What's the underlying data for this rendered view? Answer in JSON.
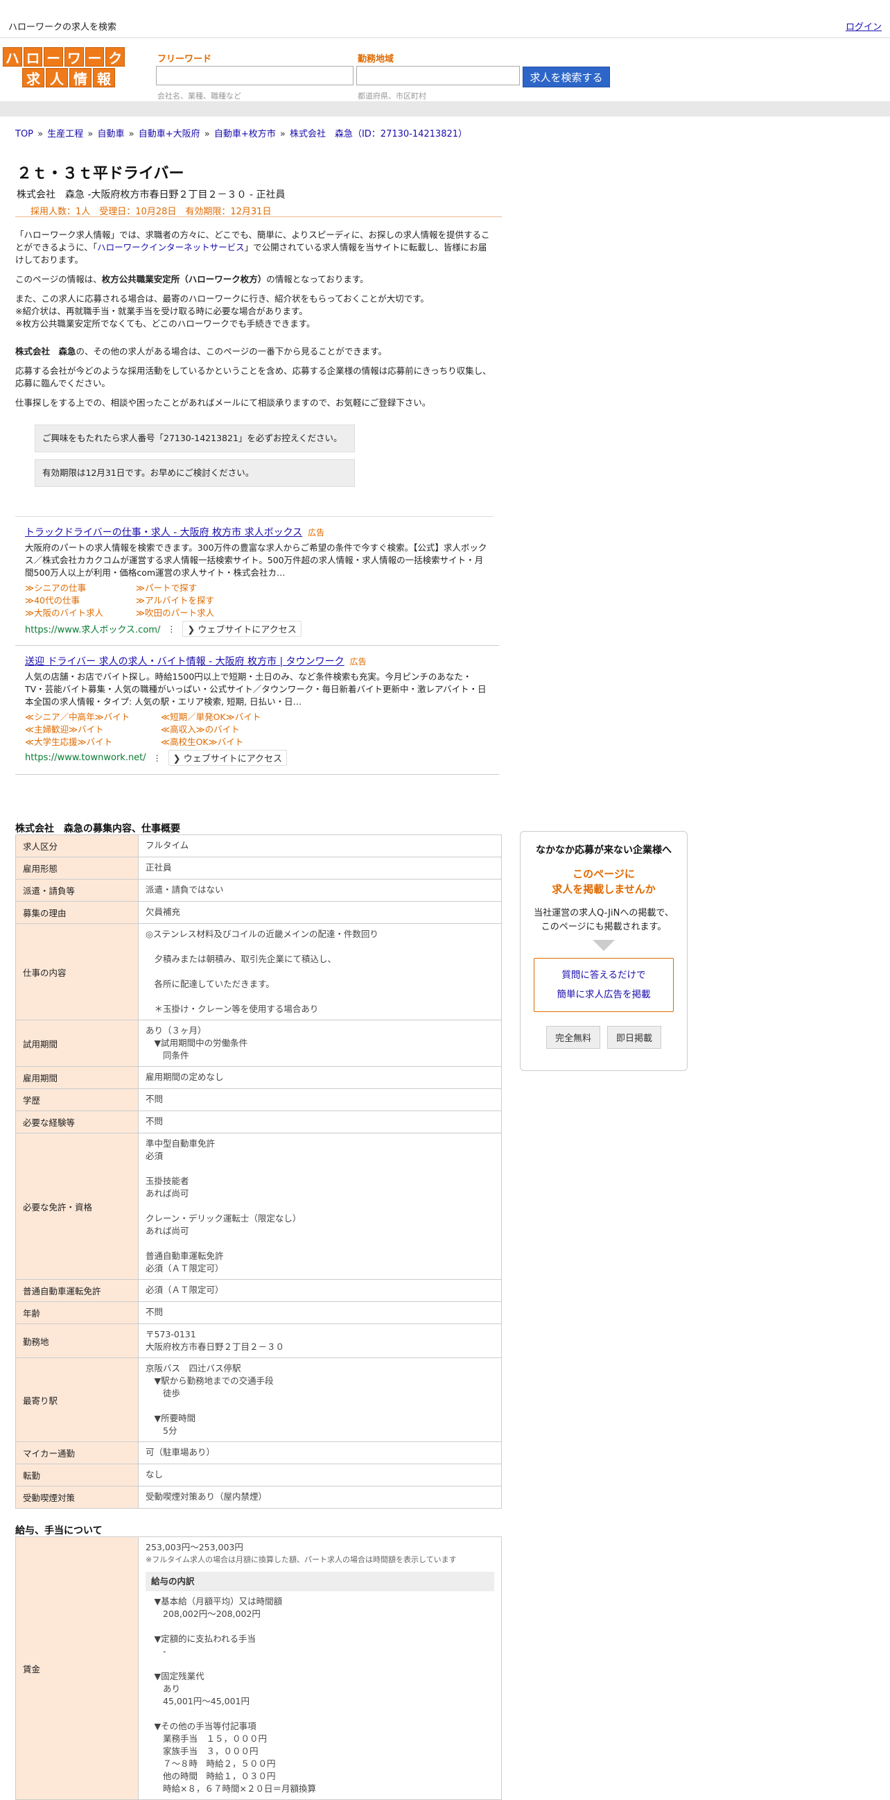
{
  "header": {
    "site_title": "ハローワークの求人を検索",
    "login_label": "ログイン",
    "logo": {
      "row1": [
        "ハ",
        "ロ",
        "ー",
        "ワ",
        "ー",
        "ク"
      ],
      "row2": [
        "求",
        "人",
        "情",
        "報"
      ]
    },
    "keyword_label": "フリーワード",
    "keyword_hint": "会社名、業種、職種など",
    "area_label": "勤務地域",
    "area_hint": "都道府県、市区町村",
    "search_button": "求人を検索する"
  },
  "breadcrumb": [
    "TOP",
    "生産工程",
    "自動車",
    "自動車+大阪府",
    "自動車+枚方市",
    "株式会社　森急（ID：27130-14213821）"
  ],
  "job": {
    "title": "２ｔ・３ｔ平ドライバー",
    "company_line": "株式会社　森急 -大阪府枚方市春日野２丁目２－３０ - 正社員",
    "meta": "採用人数：1人　受理日：10月28日　有効期限：12月31日"
  },
  "intro": {
    "p1_a": "「ハローワーク求人情報」では、求職者の方々に、どこでも、簡単に、よりスピーディに、お探しの求人情報を提供することができるように、「",
    "p1_link": "ハローワークインターネットサービス",
    "p1_b": "」で公開されている求人情報を当サイトに転載し、皆様にお届けしております。",
    "p2_a": "このページの情報は、",
    "p2_bold": "枚方公共職業安定所（ハローワーク枚方）",
    "p2_b": "の情報となっております。",
    "p3": "また、この求人に応募される場合は、最寄のハローワークに行き、紹介状をもらっておくことが大切です。\n※紹介状は、再就職手当・就業手当を受け取る時に必要な場合があります。\n※枚方公共職業安定所でなくても、どこのハローワークでも手続きできます。",
    "p4_bold": "株式会社　森急",
    "p4_rest": "の、その他の求人がある場合は、このページの一番下から見ることができます。",
    "p5": "応募する会社が今どのような採用活動をしているかということを含め、応募する企業様の情報は応募前にきっちり収集し、応募に臨んでください。",
    "p6": "仕事探しをする上での、相談や困ったことがあればメールにて相談承りますので、お気軽にご登録下さい。",
    "notice1": "ご興味をもたれたら求人番号「27130-14213821」を必ずお控えください。",
    "notice2": "有効期限は12月31日です。お早めにご検討ください。"
  },
  "ads": [
    {
      "title": "トラックドライバーの仕事・求人 - 大阪府 枚方市 求人ボックス",
      "tag": "広告",
      "desc": "大阪府のパートの求人情報を検索できます。300万件の豊富な求人からご希望の条件で今すぐ検索。【公式】求人ボックス／株式会社カカクコムが運営する求人情報一括検索サイト。500万件超の求人情報・求人情報の一括検索サイト・月間500万人以上が利用・価格com運営の求人サイト・株式会社カ…",
      "links": [
        "≫シニアの仕事",
        "≫パートで探す",
        "≫40代の仕事",
        "≫アルバイトを探す",
        "≫大阪のバイト求人",
        "≫吹田のパート求人"
      ],
      "url": "https://www.求人ボックス.com/",
      "visit": "❯ ウェブサイトにアクセス"
    },
    {
      "title": "送迎 ドライバー 求人の求人・バイト情報 - 大阪府 枚方市 | タウンワーク",
      "tag": "広告",
      "desc": "人気の店舗・お店でバイト探し。時給1500円以上で短期・土日のみ、など条件検索も充実。今月ピンチのあなた・TV・芸能バイト募集・人気の職種がいっぱい・公式サイト／タウンワーク・毎日新着バイト更新中・激レアバイト・日本全国の求人情報・タイプ: 人気の駅・エリア検索, 短期, 日払い・日…",
      "links": [
        "≪シニア／中高年≫バイト",
        "≪短期／単発OK≫バイト",
        "≪主婦歓迎≫バイト",
        "≪高収入≫のバイト",
        "≪大学生応援≫バイト",
        "≪高校生OK≫バイト"
      ],
      "url": "https://www.townwork.net/",
      "visit": "❯ ウェブサイトにアクセス"
    }
  ],
  "overview": {
    "title": "株式会社　森急の募集内容、仕事概要",
    "rows": [
      {
        "label": "求人区分",
        "value": "フルタイム"
      },
      {
        "label": "雇用形態",
        "value": "正社員"
      },
      {
        "label": "派遣・請負等",
        "value": "派遣・請負ではない"
      },
      {
        "label": "募集の理由",
        "value": "欠員補充"
      },
      {
        "label": "仕事の内容",
        "value": "◎ステンレス材料及びコイルの近畿メインの配達・件数回り\n\n　夕積みまたは朝積み、取引先企業にて積込し、\n\n　各所に配達していただきます。\n\n　＊玉掛け・クレーン等を使用する場合あり"
      },
      {
        "label": "試用期間",
        "value": "あり（３ヶ月）\n　▼試用期間中の労働条件\n　　同条件"
      },
      {
        "label": "雇用期間",
        "value": "雇用期間の定めなし"
      },
      {
        "label": "学歴",
        "value": "不問"
      },
      {
        "label": "必要な経験等",
        "value": "不問"
      },
      {
        "label": "必要な免許・資格",
        "value": "準中型自動車免許\n必須\n\n玉掛技能者\nあれば尚可\n\nクレーン・デリック運転士（限定なし）\nあれば尚可\n\n普通自動車運転免許\n必須（ＡＴ限定可）"
      },
      {
        "label": "普通自動車運転免許",
        "value": "必須（ＡＴ限定可）"
      },
      {
        "label": "年齢",
        "value": "不問"
      },
      {
        "label": "勤務地",
        "value": "〒573-0131\n大阪府枚方市春日野２丁目２－３０"
      },
      {
        "label": "最寄り駅",
        "value": "京阪バス　四辻バス停駅\n　▼駅から勤務地までの交通手段\n　　徒歩\n\n　▼所要時間\n　　5分"
      },
      {
        "label": "マイカー通勤",
        "value": "可（駐車場あり）"
      },
      {
        "label": "転勤",
        "value": "なし"
      },
      {
        "label": "受動喫煙対策",
        "value": "受動喫煙対策あり（屋内禁煙）"
      }
    ]
  },
  "wages": {
    "title": "給与、手当について",
    "label": "賃金",
    "range": "253,003円〜253,003円",
    "note": "※フルタイム求人の場合は月額に換算した額、パート求人の場合は時間額を表示しています",
    "breakdown_title": "給与の内訳",
    "items": "　▼基本給（月額平均）又は時間額\n　　208,002円〜208,002円\n\n　▼定額的に支払われる手当\n　　-\n\n　▼固定残業代\n　　あり\n　　45,001円〜45,001円\n\n　▼その他の手当等付記事項\n　　業務手当　１５，０００円\n　　家族手当　３，０００円\n　　７～８時　時給２，５００円\n　　他の時間　時給１，０３０円\n　　時給×８，６７時間×２０日＝月額換算"
  },
  "sidebar": {
    "heading": "なかなか応募が来ない企業様へ",
    "catch": "このページに\n求人を掲載しませんか",
    "desc": "当社運営の求人Q-JiNへの掲載で、\nこのページにも掲載されます。",
    "link1": "質問に答えるだけで",
    "link2": "簡単に求人広告を掲載",
    "btn1": "完全無料",
    "btn2": "即日掲載"
  }
}
